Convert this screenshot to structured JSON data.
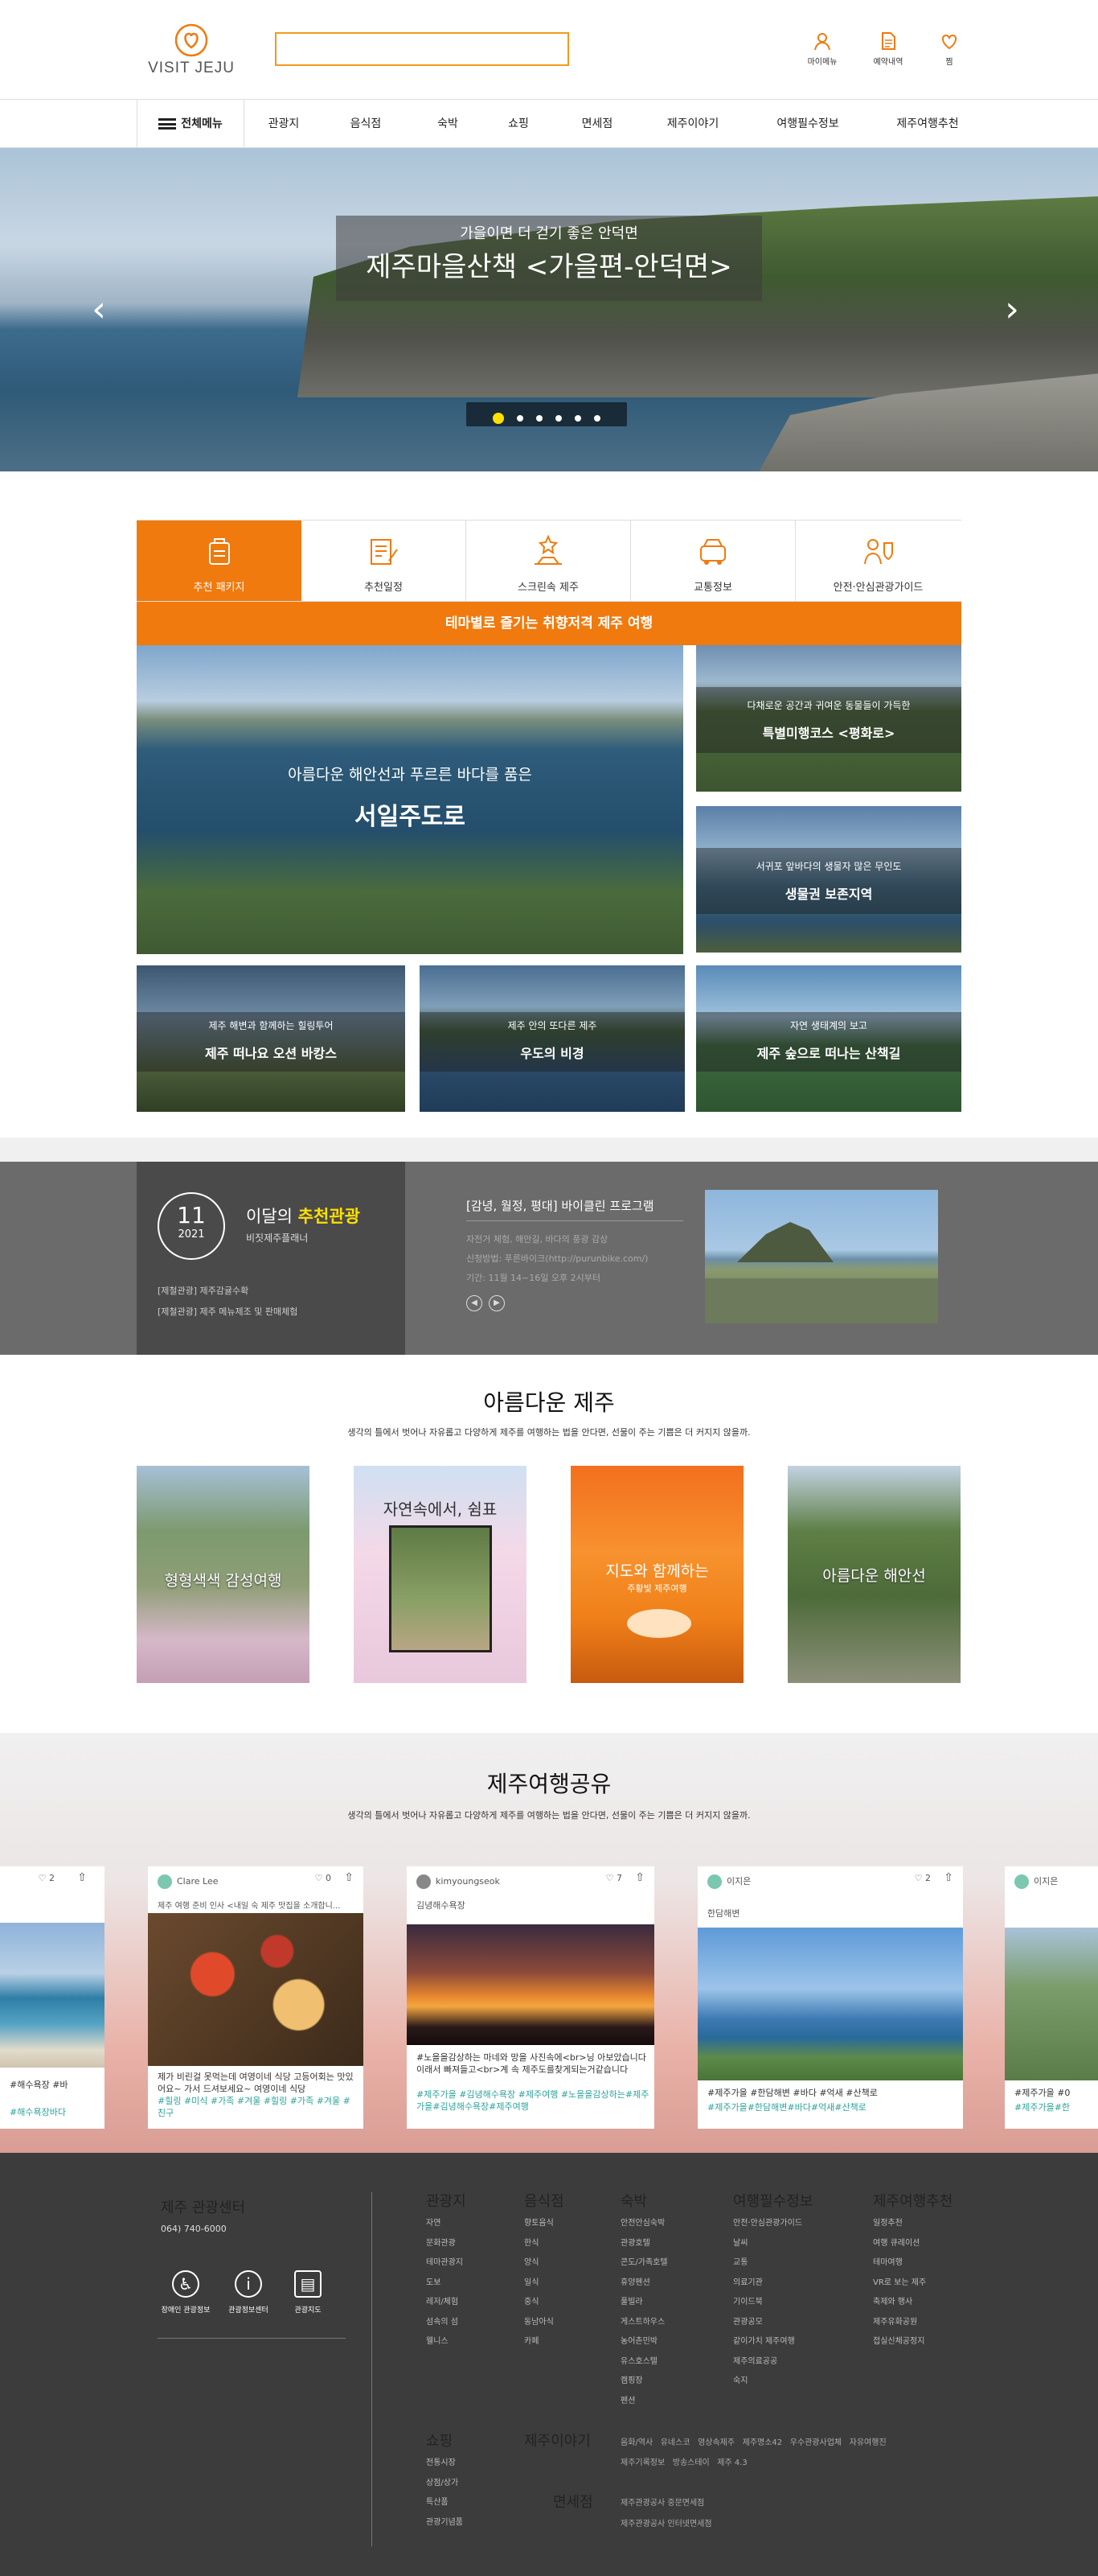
{
  "header": {
    "logo_text": "VISIT JEJU",
    "search_placeholder": "",
    "util": [
      {
        "label": "마이메뉴",
        "icon": "user-icon"
      },
      {
        "label": "예약내역",
        "icon": "document-icon"
      },
      {
        "label": "찜",
        "icon": "heart-icon"
      }
    ]
  },
  "nav": {
    "all_menu": "전체메뉴",
    "items": [
      "관광지",
      "음식점",
      "숙박",
      "쇼핑",
      "면세점",
      "제주이야기",
      "여행필수정보",
      "제주여행추천"
    ]
  },
  "hero": {
    "subtitle": "가을이면 더 걷기 좋은 안덕면",
    "title": "제주마을산책 <가을편-안덕면>",
    "slides": 6,
    "active_slide": 1,
    "prev_icon": "chevron-left-icon",
    "next_icon": "chevron-right-icon"
  },
  "tabs": [
    {
      "label": "추천 패키지",
      "icon": "package-icon"
    },
    {
      "label": "추천일정",
      "icon": "schedule-icon"
    },
    {
      "label": "스크린속 제주",
      "icon": "star-hand-icon"
    },
    {
      "label": "교통정보",
      "icon": "car-icon"
    },
    {
      "label": "안전·안심관광가이드",
      "icon": "safety-guide-icon"
    }
  ],
  "theme": {
    "bar_title": "테마별로 즐기는 취향저격 제주 여행",
    "main": {
      "sub": "아름다운 해안선과 푸르른 바다를 품은",
      "title": "서일주도로"
    },
    "right1": {
      "sub": "다채로운 공간과 귀여운 동물들이 가득한",
      "title": "특별미행코스 <평화로>"
    },
    "right2": {
      "sub": "서귀포 앞바다의 생물자 많은 무인도",
      "title": "생물권 보존지역"
    },
    "bottom1": {
      "sub": "제주 해변과 함께하는 힐링투어",
      "title": "제주 떠나요 오션 바캉스"
    },
    "bottom2": {
      "sub": "제주 안의 또다른 제주",
      "title": "우도의 비경"
    },
    "bottom3": {
      "sub": "자연 생태계의 보고",
      "title": "제주 숲으로 떠나는 산책길"
    }
  },
  "monthly": {
    "month": "11",
    "year": "2021",
    "title_prefix": "이달의 ",
    "title_highlight": "추천관광",
    "planner": "비짓제주플래너",
    "links": [
      "[제철관광] 제주감귤수확",
      "[제철관광] 제주 메뉴제조 및 판매체험"
    ],
    "program_title": "[감녕, 월정, 평대] 바이클린 프로그램",
    "details": [
      "자전거 체험, 해안길, 바다의 풍광 감상",
      "신청방법: 푸른바이크(http://purunbike.com/)",
      "기간: 11월 14~16일 오후 2시부터"
    ],
    "prev_icon": "circle-left-icon",
    "next_icon": "circle-right-icon"
  },
  "beautiful": {
    "title": "아름다운 제주",
    "subtitle": "생각의 틀에서 벗어나 자유롭고 다양하게 제주를 여행하는 법을 안다면, 선물이 주는 기쁨은 더 커지지 않을까.",
    "cards": [
      {
        "title": "형형색색 감성여행",
        "sub": ""
      },
      {
        "title": "자연속에서, 쉼표",
        "sub": ""
      },
      {
        "title": "지도와 함께하는",
        "sub": "주황빛 제주여행"
      },
      {
        "title": "아름다운 해안선",
        "sub": ""
      }
    ]
  },
  "share": {
    "title": "제주여행공유",
    "subtitle": "생각의 틀에서 벗어나 자유롭고 다양하게 제주를 여행하는 법을 안다면, 선물이 주는 기쁨은 더 커지지 않을까.",
    "cards": [
      {
        "user": "",
        "likes": "2",
        "place": "",
        "caption": "#해수욕장 #바",
        "tags": "#해수욕장바다"
      },
      {
        "user": "Clare Lee",
        "likes": "0",
        "place": "제주 여행 준비 인사 <내일 숙 제주 맛집을 소개합니...",
        "caption": "제가 비린걸 못먹는데 여영이네 식당 고등어회는 맛있어요~ 가서 드셔보세요~ 여영이네 식당",
        "tags": "#힐링 #미식 #가족 #겨울 #힐링 #가족 #겨울 #친구"
      },
      {
        "user": "kimyoungseok",
        "likes": "7",
        "place": "김녕해수욕장",
        "caption": "#노을을감상하는 마네와 망을 사진속에<br>닝 아보았습니다 이래서 빠져들고<br>계 속 제주도를찾게되는거같습니다",
        "tags": "#제주가을 #김녕해수욕장 #제주여행 #노을을감상하는#제주가을#김녕해수욕장#제주여행"
      },
      {
        "user": "이지은",
        "likes": "2",
        "place": "한담해변",
        "caption": "#제주가을 #한담해변 #바다 #억새 #산책로",
        "tags": "#제주가을#한담해변#바다#억새#산책로"
      },
      {
        "user": "이지은",
        "likes": "",
        "place": "",
        "caption": "#제주가을 #0",
        "tags": "#제주가을#한"
      }
    ],
    "like_icon": "heart-outline-icon",
    "share_icon": "share-icon"
  },
  "footer": {
    "center": "제주 관광센터",
    "phone": "064) 740-6000",
    "icons": [
      {
        "label": "장애인 관광정보",
        "icon": "wheelchair-icon"
      },
      {
        "label": "관광정보센터",
        "icon": "info-icon"
      },
      {
        "label": "관광지도",
        "icon": "map-icon"
      }
    ],
    "columns": [
      {
        "title": "관광지",
        "items": [
          "자연",
          "문화관광",
          "테마관광지",
          "도보",
          "레저/체험",
          "섬속의 섬",
          "웰니스"
        ]
      },
      {
        "title": "음식점",
        "items": [
          "향토음식",
          "한식",
          "양식",
          "일식",
          "중식",
          "동남아식",
          "카페"
        ]
      },
      {
        "title": "숙박",
        "items": [
          "안전안심숙박",
          "관광호텔",
          "콘도/가족호텔",
          "휴양펜션",
          "풀빌라",
          "게스트하우스",
          "농어촌민박",
          "유스호스텔",
          "캠핑장",
          "펜션"
        ]
      },
      {
        "title": "여행필수정보",
        "items": [
          "안전·안심관광가이드",
          "날씨",
          "교통",
          "의료기관",
          "기이드북",
          "관광공모",
          "같이가치 제주여행",
          "제주의료공공",
          "숙지"
        ]
      },
      {
        "title": "제주여행추천",
        "items": [
          "일정추천",
          "여행 큐레이션",
          "테마여행",
          "VR로 보는 제주",
          "축제와 행사",
          "제주유화공원",
          "접실신체공정지"
        ]
      }
    ],
    "shopping": {
      "title": "쇼핑",
      "items": [
        "전통시장",
        "상점/상가",
        "특산품",
        "관광기념품"
      ]
    },
    "story": {
      "title": "제주이야기"
    },
    "dutyfree": {
      "title": "면세점"
    },
    "story_links_row1": [
      "음화/역사",
      "유네스코",
      "영상속제주",
      "제주명소42",
      "우수관광사업체",
      "자유여행진"
    ],
    "story_links_row2": [
      "제주기록정보",
      "방송스테이",
      "제주 4.3"
    ],
    "dutyfree_links": [
      "제주관광공사 중문면세점",
      "제주관광공사 인터넷면세점"
    ]
  }
}
